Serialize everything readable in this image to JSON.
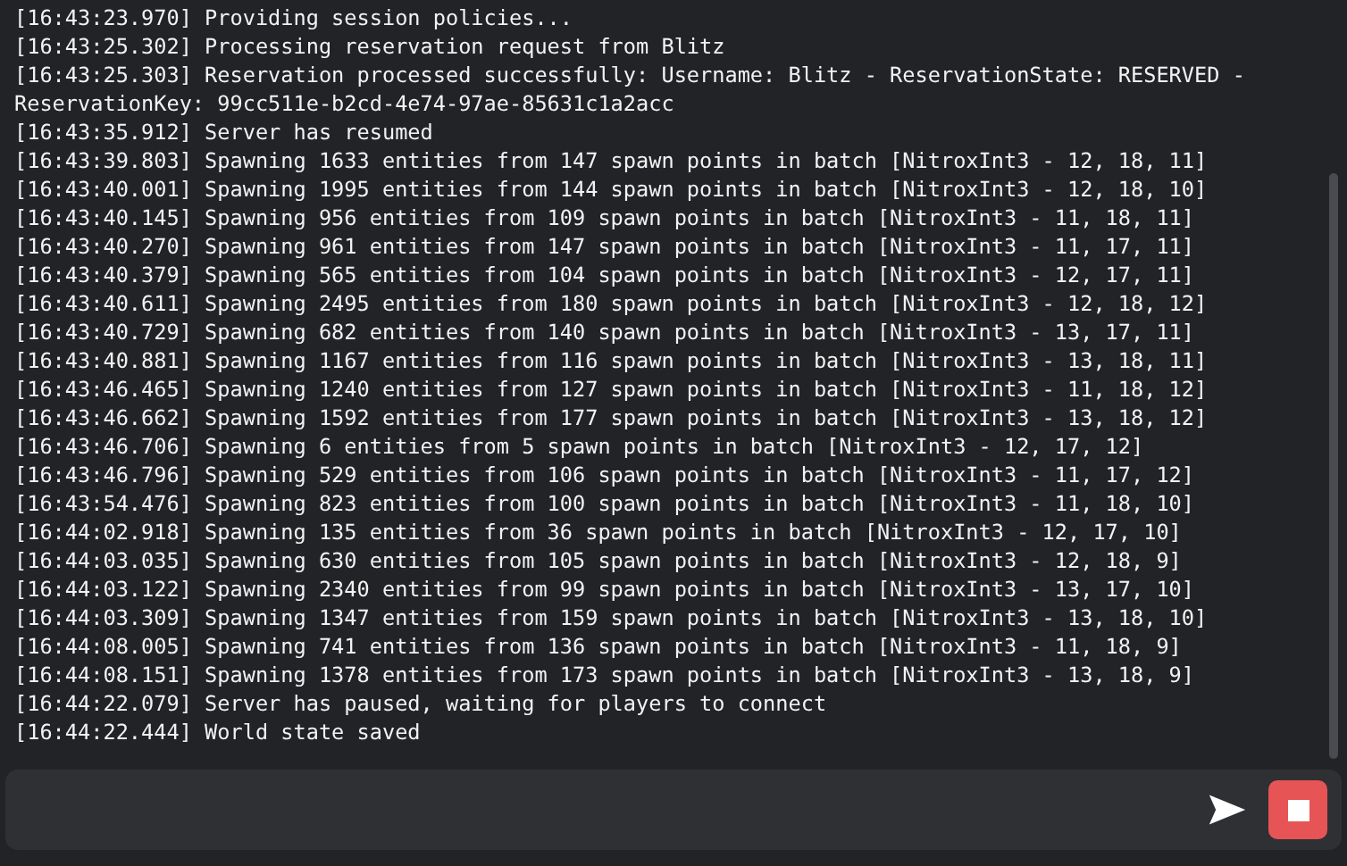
{
  "log": {
    "lines": [
      "[16:43:23.970] Providing session policies...",
      "[16:43:25.302] Processing reservation request from Blitz",
      "[16:43:25.303] Reservation processed successfully: Username: Blitz - ReservationState: RESERVED - ReservationKey: 99cc511e-b2cd-4e74-97ae-85631c1a2acc",
      "[16:43:35.912] Server has resumed",
      "[16:43:39.803] Spawning 1633 entities from 147 spawn points in batch [NitroxInt3 - 12, 18, 11]",
      "[16:43:40.001] Spawning 1995 entities from 144 spawn points in batch [NitroxInt3 - 12, 18, 10]",
      "[16:43:40.145] Spawning 956 entities from 109 spawn points in batch [NitroxInt3 - 11, 18, 11]",
      "[16:43:40.270] Spawning 961 entities from 147 spawn points in batch [NitroxInt3 - 11, 17, 11]",
      "[16:43:40.379] Spawning 565 entities from 104 spawn points in batch [NitroxInt3 - 12, 17, 11]",
      "[16:43:40.611] Spawning 2495 entities from 180 spawn points in batch [NitroxInt3 - 12, 18, 12]",
      "[16:43:40.729] Spawning 682 entities from 140 spawn points in batch [NitroxInt3 - 13, 17, 11]",
      "[16:43:40.881] Spawning 1167 entities from 116 spawn points in batch [NitroxInt3 - 13, 18, 11]",
      "[16:43:46.465] Spawning 1240 entities from 127 spawn points in batch [NitroxInt3 - 11, 18, 12]",
      "[16:43:46.662] Spawning 1592 entities from 177 spawn points in batch [NitroxInt3 - 13, 18, 12]",
      "[16:43:46.706] Spawning 6 entities from 5 spawn points in batch [NitroxInt3 - 12, 17, 12]",
      "[16:43:46.796] Spawning 529 entities from 106 spawn points in batch [NitroxInt3 - 11, 17, 12]",
      "[16:43:54.476] Spawning 823 entities from 100 spawn points in batch [NitroxInt3 - 11, 18, 10]",
      "[16:44:02.918] Spawning 135 entities from 36 spawn points in batch [NitroxInt3 - 12, 17, 10]",
      "[16:44:03.035] Spawning 630 entities from 105 spawn points in batch [NitroxInt3 - 12, 18, 9]",
      "[16:44:03.122] Spawning 2340 entities from 99 spawn points in batch [NitroxInt3 - 13, 17, 10]",
      "[16:44:03.309] Spawning 1347 entities from 159 spawn points in batch [NitroxInt3 - 13, 18, 10]",
      "[16:44:08.005] Spawning 741 entities from 136 spawn points in batch [NitroxInt3 - 11, 18, 9]",
      "[16:44:08.151] Spawning 1378 entities from 173 spawn points in batch [NitroxInt3 - 13, 18, 9]",
      "[16:44:22.079] Server has paused, waiting for players to connect",
      "[16:44:22.444] World state saved"
    ]
  }
}
